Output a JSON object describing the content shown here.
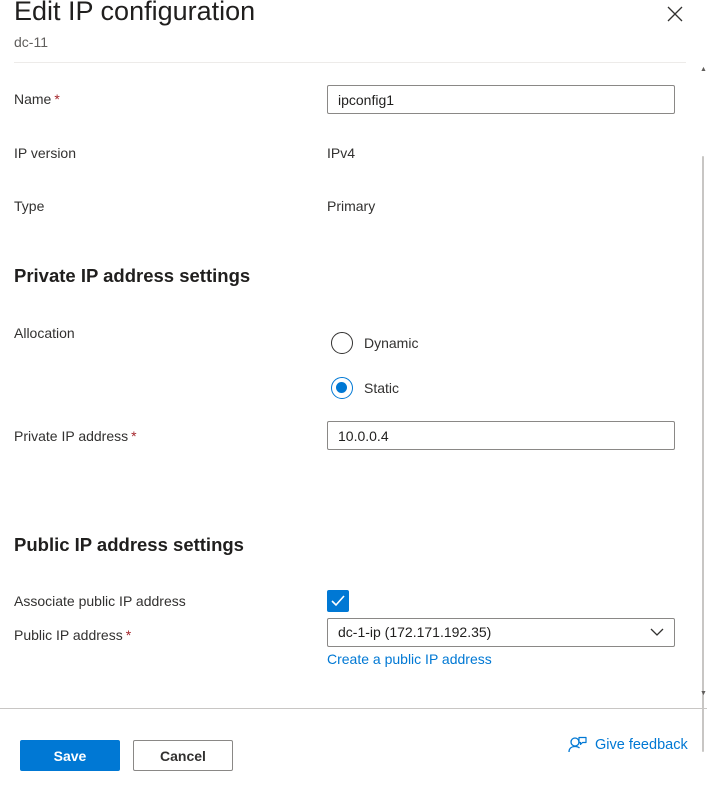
{
  "header": {
    "title": "Edit IP configuration",
    "subtitle": "dc-11",
    "close_icon": "close-icon"
  },
  "form": {
    "name": {
      "label": "Name",
      "required": "*",
      "value": "ipconfig1"
    },
    "ip_version": {
      "label": "IP version",
      "value": "IPv4"
    },
    "type": {
      "label": "Type",
      "value": "Primary"
    },
    "private_section": {
      "heading": "Private IP address settings"
    },
    "allocation": {
      "label": "Allocation",
      "options": [
        {
          "label": "Dynamic",
          "checked": false
        },
        {
          "label": "Static",
          "checked": true
        }
      ]
    },
    "private_ip": {
      "label": "Private IP address",
      "required": "*",
      "value": "10.0.0.4"
    },
    "public_section": {
      "heading": "Public IP address settings"
    },
    "associate_public": {
      "label": "Associate public IP address",
      "checked": true
    },
    "public_ip": {
      "label": "Public IP address",
      "required": "*",
      "selected": "dc-1-ip (172.171.192.35)",
      "create_link": "Create a public IP address"
    }
  },
  "footer": {
    "save_label": "Save",
    "cancel_label": "Cancel",
    "feedback_label": "Give feedback",
    "feedback_icon": "person-feedback-icon"
  },
  "colors": {
    "accent": "#0078d4",
    "required": "#a4262c",
    "text": "#323130"
  }
}
